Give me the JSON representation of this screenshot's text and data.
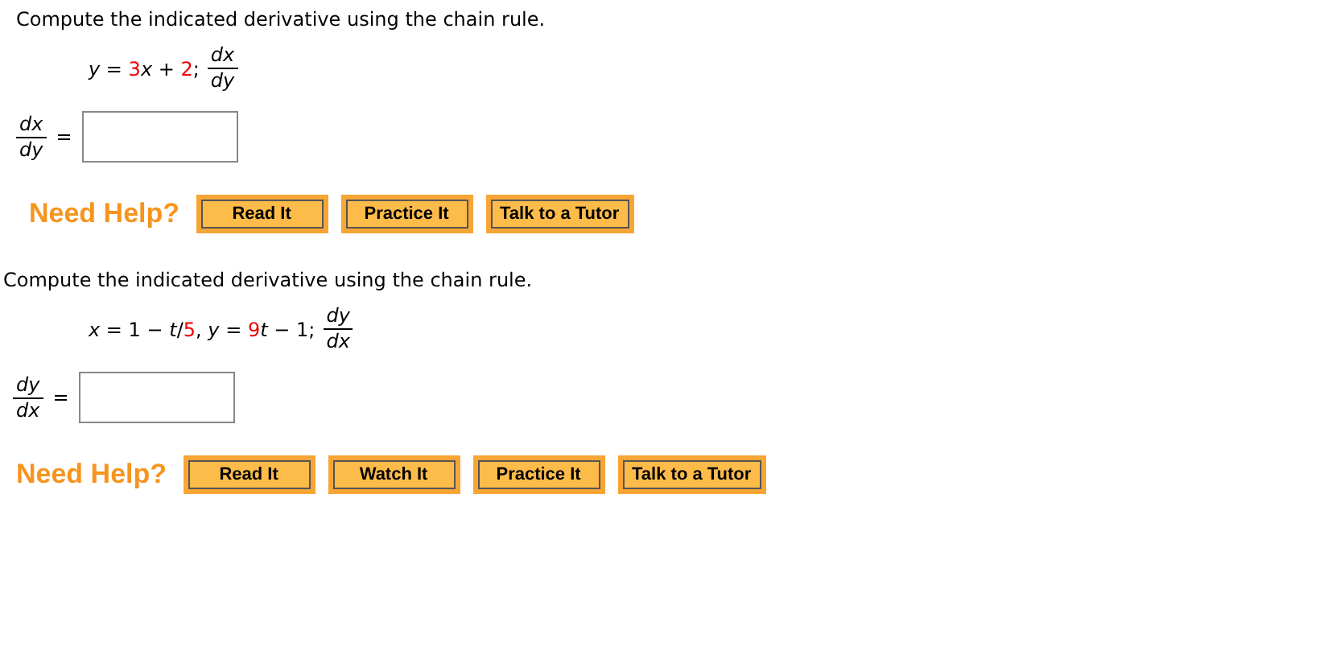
{
  "problems": [
    {
      "prompt": "Compute the indicated derivative using the chain rule.",
      "equation": [
        {
          "kind": "plain",
          "text": "*y* = "
        },
        {
          "kind": "given",
          "text": "3"
        },
        {
          "kind": "plain",
          "text": "*x* + "
        },
        {
          "kind": "given",
          "text": "2"
        },
        {
          "kind": "plain",
          "text": ";"
        }
      ],
      "target": {
        "numerator": "dx",
        "denominator": "dy"
      },
      "answer": {
        "numerator": "dx",
        "denominator": "dy",
        "equals": "="
      },
      "help_label": "Need Help?",
      "buttons": [
        "Read It",
        "Practice It",
        "Talk to a Tutor"
      ]
    },
    {
      "prompt": "Compute the indicated derivative using the chain rule.",
      "equation": [
        {
          "kind": "plain",
          "text": "*x* = 1 − *t*/"
        },
        {
          "kind": "given",
          "text": "5"
        },
        {
          "kind": "plain",
          "text": ", *y* = "
        },
        {
          "kind": "given",
          "text": "9"
        },
        {
          "kind": "plain",
          "text": "*t* − 1;"
        }
      ],
      "target": {
        "numerator": "dy",
        "denominator": "dx"
      },
      "answer": {
        "numerator": "dy",
        "denominator": "dx",
        "equals": "="
      },
      "help_label": "Need Help?",
      "buttons": [
        "Read It",
        "Watch It",
        "Practice It",
        "Talk to a Tutor"
      ]
    }
  ]
}
